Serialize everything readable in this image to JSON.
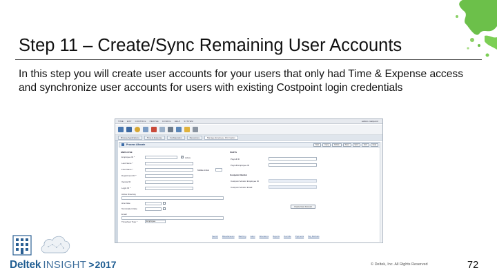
{
  "slide": {
    "title": "Step 11 – Create/Sync Remaining User Accounts",
    "body": "In this step you will create user accounts for your users that only had Time & Expense access and synchronize user accounts for users with existing Costpoint login credentials",
    "footer": {
      "brand_deltek": "Deltek",
      "brand_insight": "INSIGHT",
      "brand_arrow": ">",
      "brand_year": "2017",
      "copyright": "© Deltek, Inc. All Rights Reserved",
      "page_number": "72"
    }
  },
  "app": {
    "topbar": [
      "TIME",
      "EXP",
      "CONTROL",
      "PEOPLE",
      "CONFIG",
      "HELP",
      "SYSTEM"
    ],
    "user": "admin.costpoint",
    "tabs": [
      "Browse Applications",
      "Time & Expense",
      "Configuration",
      "Resources"
    ],
    "breadcrumb": "Manage Employee Information",
    "panel": {
      "title": "Process Allocate",
      "buttons": [
        "New",
        "Copy",
        "Delete",
        "Save",
        "Sync",
        "Exit",
        "Help"
      ]
    },
    "sections": {
      "left": "EMPLOYEE",
      "right_top": "PARTS",
      "right_bottom": "Costpoint Vendor"
    },
    "left_fields": [
      "Employee ID *",
      "Last Name *",
      "First Name *",
      "Department ID *",
      "Vendor ID",
      "Login ID *",
      "Active Directory",
      "Hire Date",
      "Termination Date",
      "Email",
      "Timesheet Type *"
    ],
    "checkbox_active": "Active",
    "middle_label": "Middle Initial",
    "timesheet_value": "Employee",
    "right_fields": [
      "Payroll ID",
      "Payroll Employee ID"
    ],
    "vendor_fields": [
      "Costpoint Vendor Employee ID",
      "Costpoint Vendor Email"
    ],
    "create_button": "Create User Account",
    "footer_links": [
      "Search",
      "Miscellaneous",
      "Batching",
      "Labor",
      "Allocations",
      "Reports",
      "Override",
      "Payments",
      "Pay Methods"
    ]
  }
}
